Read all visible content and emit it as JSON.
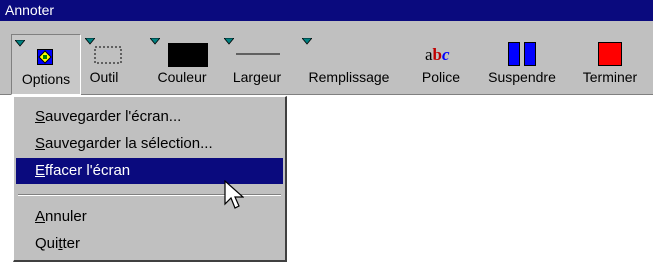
{
  "window": {
    "title": "Annoter"
  },
  "toolbar": {
    "tools": [
      {
        "label": "Options",
        "icon": "options-icon"
      },
      {
        "label": "Outil",
        "icon": "dashed-rectangle-icon"
      },
      {
        "label": "Couleur",
        "icon": "color-swatch-icon"
      },
      {
        "label": "Largeur",
        "icon": "line-width-icon"
      },
      {
        "label": "Remplissage",
        "icon": "fill-icon"
      },
      {
        "label": "Police",
        "icon": "font-icon",
        "sample": "abc"
      },
      {
        "label": "Suspendre",
        "icon": "pause-icon"
      },
      {
        "label": "Terminer",
        "icon": "stop-icon"
      }
    ]
  },
  "menu": {
    "items": [
      {
        "label": "Sauvegarder l'écran...",
        "underline": "S"
      },
      {
        "label": "Sauvegarder la sélection...",
        "underline": "S"
      },
      {
        "label": "Effacer l'écran",
        "underline": "E",
        "highlighted": true
      },
      {
        "label": "Annuler",
        "underline": "A"
      },
      {
        "label": "Quitter",
        "underline": "t"
      }
    ]
  },
  "colors": {
    "titlebar": "#0a0a7e",
    "face": "#c0c0c0",
    "highlight": "#0a0a7e",
    "dropdown_arrow": "#008080",
    "pause": "#0000ff",
    "stop": "#ff0000"
  }
}
